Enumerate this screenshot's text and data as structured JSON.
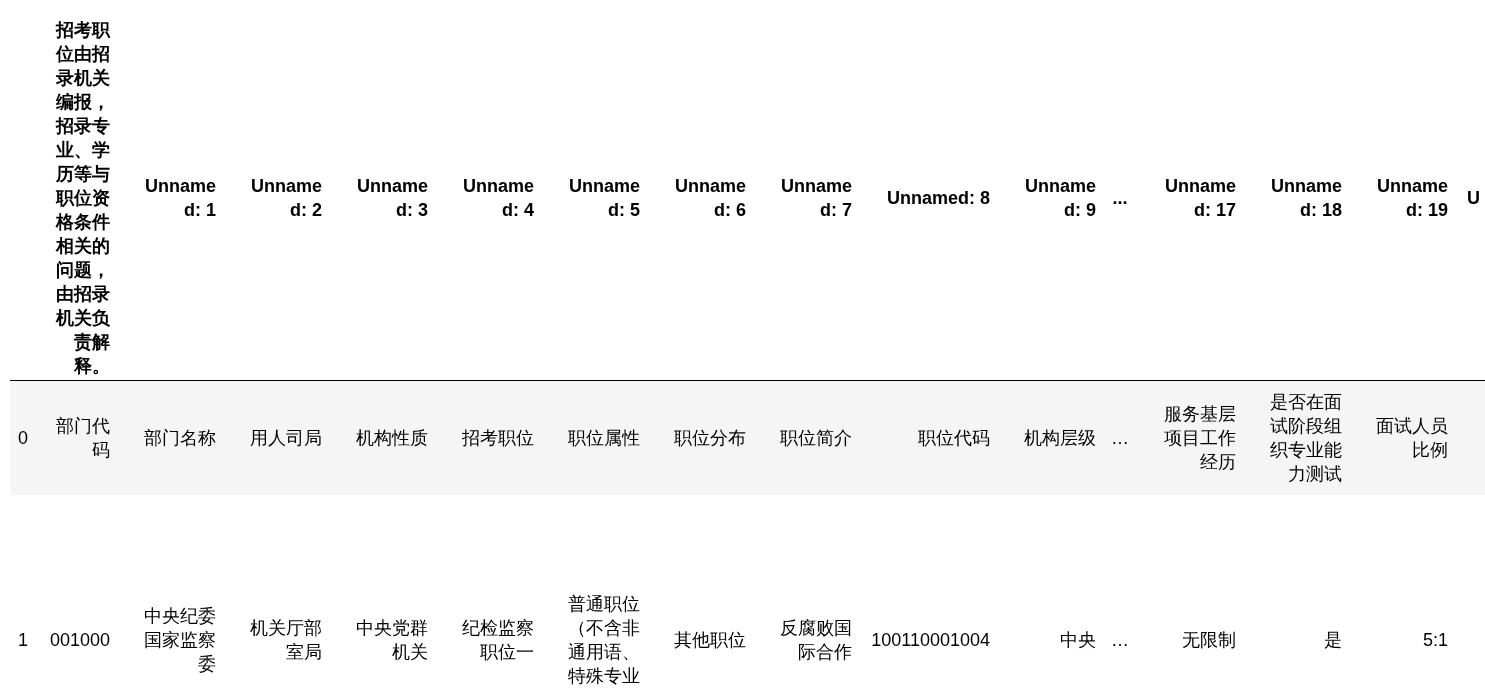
{
  "table": {
    "columns": [
      "招考职位由招录机关编报，招录专业、学历等与职位资格条件相关的问题，由招录机关负责解释。",
      "Unnamed: 1",
      "Unnamed: 2",
      "Unnamed: 3",
      "Unnamed: 4",
      "Unnamed: 5",
      "Unnamed: 6",
      "Unnamed: 7",
      "Unnamed: 8",
      "Unnamed: 9",
      "...",
      "Unnamed: 17",
      "Unnamed: 18",
      "Unnamed: 19",
      "U"
    ],
    "rows": [
      {
        "index": "0",
        "cells": [
          "部门代码",
          "部门名称",
          "用人司局",
          "机构性质",
          "招考职位",
          "职位属性",
          "职位分布",
          "职位简介",
          "职位代码",
          "机构层级",
          "…",
          "服务基层项目工作经历",
          "是否在面试阶段组织专业能力测试",
          "面试人员比例"
        ]
      },
      {
        "index": "1",
        "cells": [
          "001000",
          "中央纪委国家监察委",
          "机关厅部室局",
          "中央党群机关",
          "纪检监察职位一",
          "普通职位（不含非通用语、特殊专业",
          "其他职位",
          "反腐败国际合作",
          "100110001004",
          "中央",
          "…",
          "无限制",
          "是",
          "5:1"
        ]
      }
    ]
  }
}
